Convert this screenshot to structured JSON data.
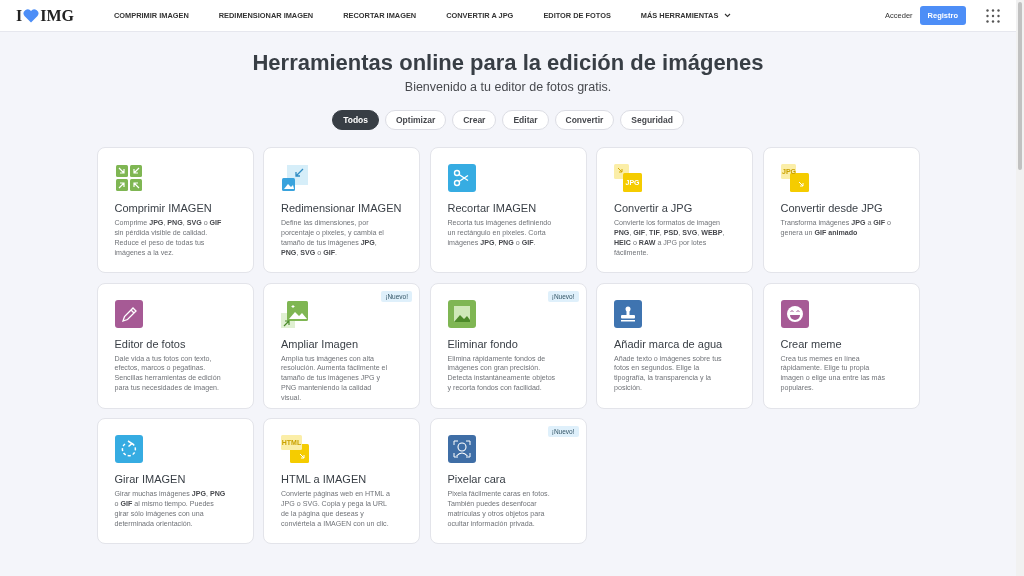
{
  "logo": {
    "left": "I",
    "right": "IMG"
  },
  "nav": [
    {
      "label": "COMPRIMIR IMAGEN",
      "dropdown": false
    },
    {
      "label": "REDIMENSIONAR IMAGEN",
      "dropdown": false
    },
    {
      "label": "RECORTAR IMAGEN",
      "dropdown": false
    },
    {
      "label": "CONVERTIR A JPG",
      "dropdown": false
    },
    {
      "label": "EDITOR DE FOTOS",
      "dropdown": false
    },
    {
      "label": "MÁS HERRAMIENTAS",
      "dropdown": true
    }
  ],
  "login": "Acceder",
  "register": "Registro",
  "title": "Herramientas online para la edición de imágenes",
  "subtitle": "Bienvenido a tu editor de fotos gratis.",
  "filters": [
    {
      "label": "Todos",
      "selected": true
    },
    {
      "label": "Optimizar",
      "selected": false
    },
    {
      "label": "Crear",
      "selected": false
    },
    {
      "label": "Editar",
      "selected": false
    },
    {
      "label": "Convertir",
      "selected": false
    },
    {
      "label": "Seguridad",
      "selected": false
    }
  ],
  "tools": [
    {
      "kind": "compress",
      "title": "Comprimir IMAGEN",
      "description": "Comprime **JPG**, **PNG**, **SVG** o **GIF** sin pérdida visible de calidad. Reduce el peso de todas tus imágenes a la vez."
    },
    {
      "kind": "resize",
      "title": "Redimensionar IMAGEN",
      "description": "Define las dimensiones, por porcentaje o pixeles, y cambia el tamaño de tus imágenes **JPG**, **PNG**, **SVG** o **GIF**."
    },
    {
      "kind": "crop",
      "title": "Recortar IMAGEN",
      "description": "Recorta tus imágenes definiendo un rectángulo en pixeles. Corta imágenes **JPG**, **PNG** o **GIF**."
    },
    {
      "kind": "to-jpg",
      "icon_text": "JPG",
      "title": "Convertir a JPG",
      "description": "Convierte los formatos de imagen **PNG**, **GIF**, **TIF**, **PSD**, **SVG**, **WEBP**, **HEIC** o **RAW** a JPG por lotes fácilmente."
    },
    {
      "kind": "from-jpg",
      "icon_text": "JPG",
      "title": "Convertir desde JPG",
      "description": "Transforma imágenes **JPG** a **GIF** o genera un **GIF animado**"
    },
    {
      "kind": "edit",
      "title": "Editor de fotos",
      "description": "Dale vida a tus fotos con texto, efectos, marcos o pegatinas. Sencillas herramientas de edición para tus necesidades de imagen."
    },
    {
      "kind": "upscale",
      "badge": "¡Nuevo!",
      "title": "Ampliar Imagen",
      "description": "Amplía tus imágenes con alta resolución. Aumenta fácilmente el tamaño de tus imágenes JPG y PNG manteniendo la calidad visual."
    },
    {
      "kind": "remove-bg",
      "badge": "¡Nuevo!",
      "title": "Eliminar fondo",
      "description": "Elimina rápidamente fondos de imágenes con gran precisión. Detecta instantáneamente objetos y recorta fondos con facilidad."
    },
    {
      "kind": "watermark",
      "title": "Añadir marca de agua",
      "description": "Añade texto o imágenes sobre tus fotos en segundos. Elige la tipografía, la transparencia y la posición."
    },
    {
      "kind": "meme",
      "title": "Crear meme",
      "description": "Crea tus memes en línea rápidamente. Elige tu propia imagen o elige una entre las más populares."
    },
    {
      "kind": "rotate",
      "title": "Girar IMAGEN",
      "description": "Girar muchas imágenes **JPG**, **PNG** o **GIF** al mismo tiempo. Puedes girar sólo imágenes con una determinada orientación."
    },
    {
      "kind": "html",
      "icon_text": "HTML",
      "title": "HTML a IMAGEN",
      "description": "Convierte páginas web en HTML a JPG o SVG. Copia y pega la URL de la página que deseas y conviértela a IMAGEN con un clic."
    },
    {
      "kind": "pixelate",
      "badge": "¡Nuevo!",
      "title": "Pixelar cara",
      "description": "Pixela fácilmente caras en fotos. También puedes desenfocar matrículas y otros objetos para ocultar información privada."
    }
  ]
}
